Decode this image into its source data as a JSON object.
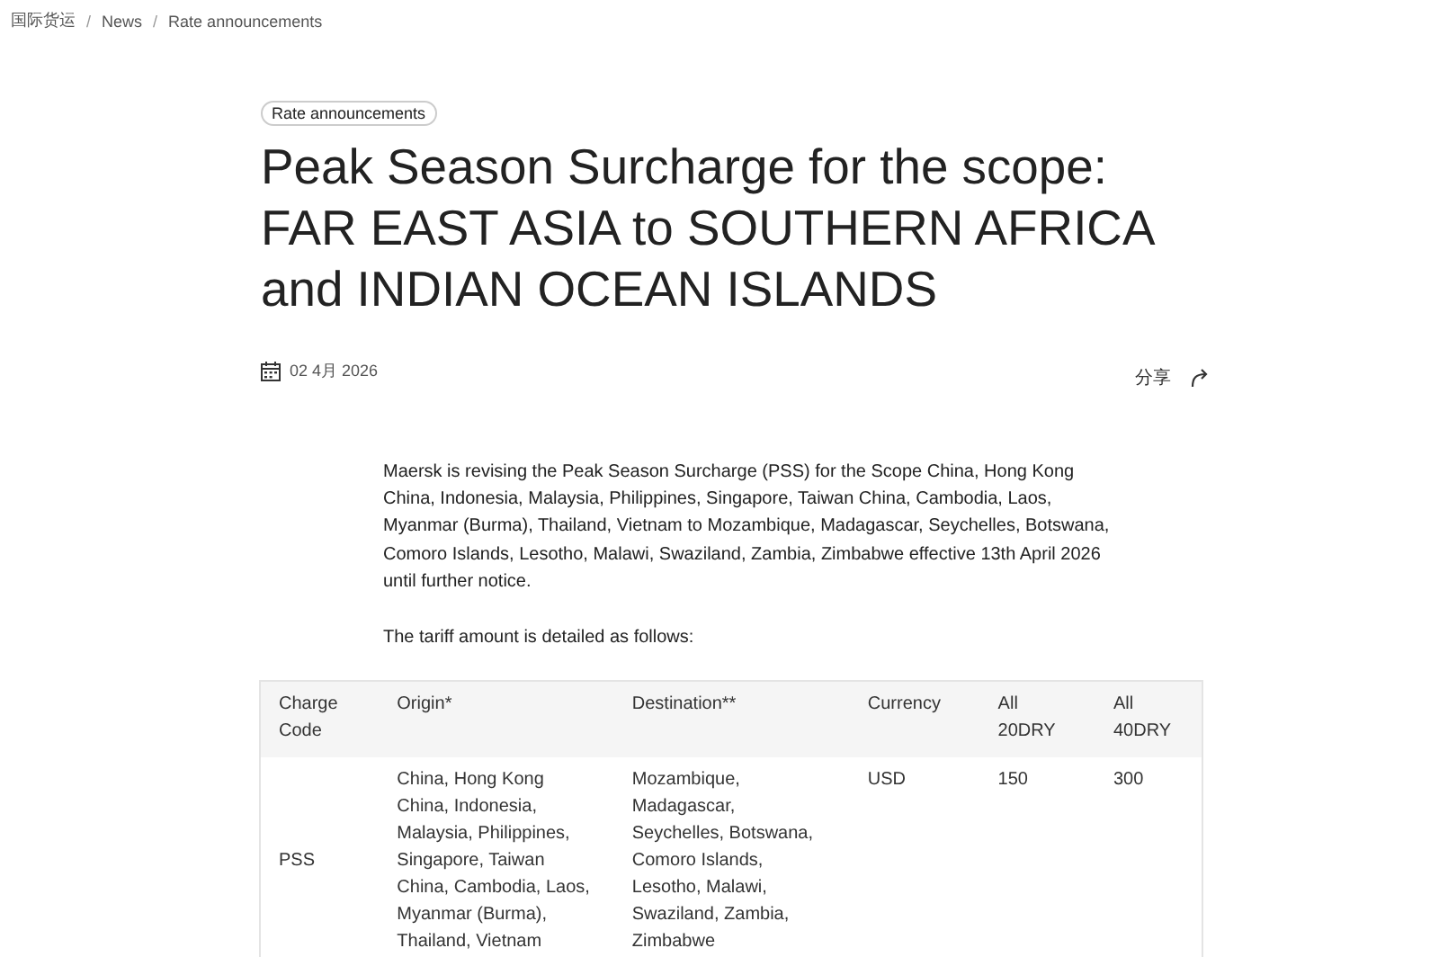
{
  "breadcrumb": [
    "国际货运",
    "News",
    "Rate announcements"
  ],
  "breadcrumb_separator": "/",
  "tag": "Rate announcements",
  "title": "Peak Season Surcharge for the scope: FAR EAST ASIA to SOUTHERN AFRICA and INDIAN OCEAN ISLANDS",
  "date": "02 4月 2026",
  "share": "分享",
  "paragraphs": [
    "Maersk is revising the Peak Season Surcharge (PSS) for the Scope China, Hong Kong China, Indonesia, Malaysia, Philippines, Singapore, Taiwan China, Cambodia, Laos, Myanmar (Burma), Thailand, Vietnam to Mozambique, Madagascar, Seychelles, Botswana, Comoro Islands, Lesotho, Malawi, Swaziland, Zambia, Zimbabwe effective 13th April 2026 until further notice.",
    "The tariff amount is detailed as follows:"
  ],
  "table": {
    "columns": [
      "Charge Code",
      "Origin*",
      "Destination**",
      "Currency",
      "All 20DRY",
      "All 40DRY"
    ],
    "rows": [
      [
        "PSS",
        "China, Hong Kong China, Indonesia, Malaysia, Philippines, Singapore, Taiwan China, Cambodia, Laos, Myanmar (Burma), Thailand, Vietnam",
        "Mozambique, Madagascar, Seychelles, Botswana, Comoro Islands, Lesotho, Malawi, Swaziland, Zambia, Zimbabwe",
        "USD",
        "150",
        "300"
      ]
    ]
  }
}
